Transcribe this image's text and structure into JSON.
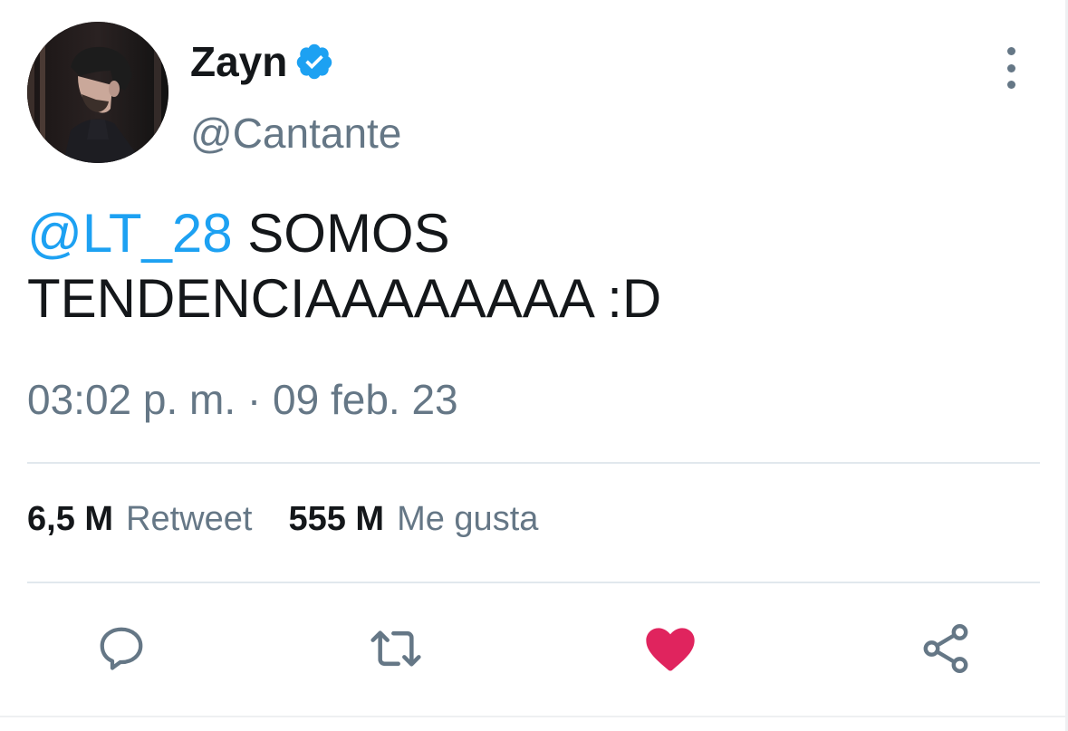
{
  "user": {
    "display_name": "Zayn",
    "handle": "@Cantante",
    "verified": true,
    "avatar_icon": "profile-photo"
  },
  "tweet": {
    "mention": "@LT_28",
    "text_line1": " SOMOS",
    "text_line2": "TENDENCIAAAAAAAA :D",
    "timestamp": "03:02 p. m. · 09 feb. 23"
  },
  "stats": {
    "retweets_value": "6,5 M",
    "retweets_label": "Retweet",
    "likes_value": "555 M",
    "likes_label": "Me gusta"
  },
  "actions": [
    {
      "icon": "reply-icon"
    },
    {
      "icon": "retweet-icon"
    },
    {
      "icon": "heart-icon",
      "active": true
    },
    {
      "icon": "share-icon"
    }
  ],
  "colors": {
    "accent": "#1da1f2",
    "secondary_text": "#657786",
    "like": "#e0245e",
    "divider": "#e1e8ed"
  }
}
